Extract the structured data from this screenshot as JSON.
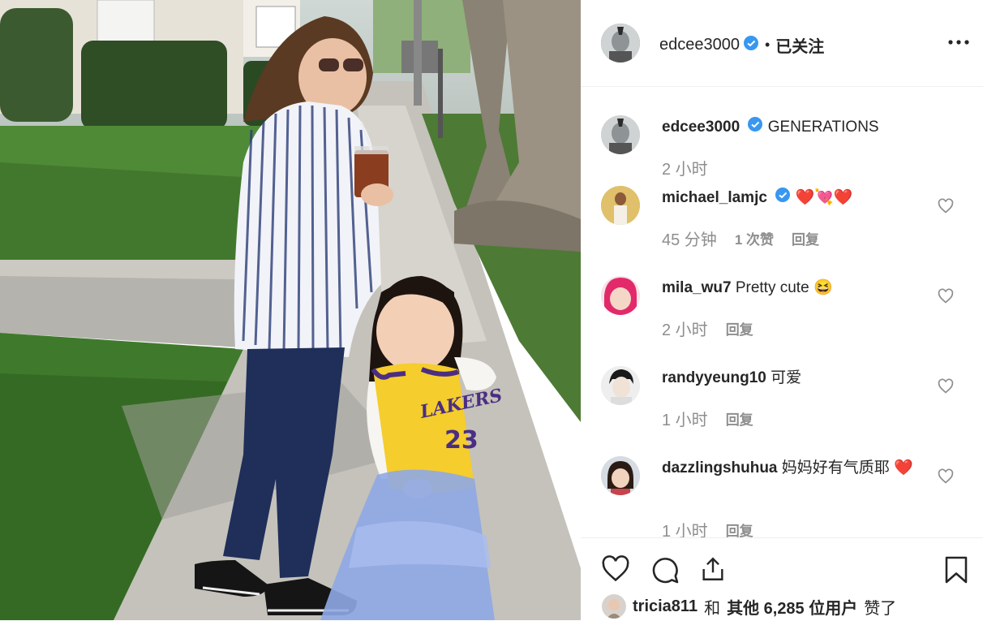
{
  "post": {
    "author": "edcee3000",
    "follow_status": "已关注",
    "separator": "•",
    "more_icon": "more-horizontal-icon"
  },
  "caption": {
    "username": "edcee3000",
    "text": "GENERATIONS",
    "time": "2 小时"
  },
  "comments": [
    {
      "username": "michael_lamjc",
      "verified": true,
      "text": "",
      "emoji": [
        "❤️",
        "💘",
        "❤️"
      ],
      "time": "45 分钟",
      "likes": "1 次赞",
      "reply": "回复"
    },
    {
      "username": "mila_wu7",
      "verified": false,
      "text": "Pretty cute",
      "emoji": [
        "😆"
      ],
      "time": "2 小时",
      "likes": "",
      "reply": "回复"
    },
    {
      "username": "randyyeung10",
      "verified": false,
      "text": "可爱",
      "emoji": [],
      "time": "1 小时",
      "likes": "",
      "reply": "回复"
    },
    {
      "username": "dazzlingshuhua",
      "verified": false,
      "text": "妈妈好有气质耶",
      "emoji": [
        "❤️"
      ],
      "time": "1 小时",
      "likes": "",
      "reply": "回复"
    }
  ],
  "likes_line": {
    "user": "tricia811",
    "conj": "和",
    "others": "其他 6,285 位用户",
    "suffix": "赞了"
  },
  "photo_text": {
    "jersey_team": "LAKERS",
    "jersey_number": "23"
  },
  "colors": {
    "verified": "#3897f0",
    "muted": "#8e8e8e",
    "text": "#262626",
    "heart": "#ed4956"
  }
}
